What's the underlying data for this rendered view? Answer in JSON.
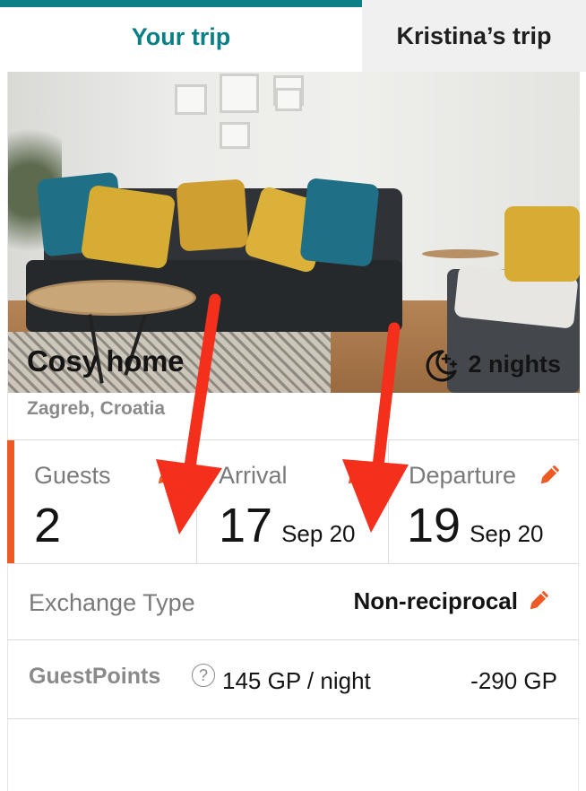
{
  "tabs": [
    {
      "label": "Your trip",
      "active": true
    },
    {
      "label": "Kristina’s trip",
      "active": false
    }
  ],
  "home": {
    "title": "Cosy home",
    "location": "Zagreb, Croatia",
    "nights_label": "2 nights"
  },
  "stats": {
    "guests": {
      "label": "Guests",
      "value": "2"
    },
    "arrival": {
      "label": "Arrival",
      "day": "17",
      "month": "Sep 20"
    },
    "departure": {
      "label": "Departure",
      "day": "19",
      "month": "Sep 20"
    }
  },
  "exchange": {
    "label": "Exchange Type",
    "value": "Non-reciprocal"
  },
  "guestpoints": {
    "label": "GuestPoints",
    "help": "?",
    "rate": "145 GP / night",
    "total": "-290 GP"
  },
  "colors": {
    "accent_teal": "#0a7f86",
    "accent_orange": "#ed5a24",
    "annotation_red": "#f4301c"
  },
  "icons": {
    "nights": "moon-stars-icon",
    "edit": "pencil-icon",
    "help": "question-circle-icon"
  }
}
